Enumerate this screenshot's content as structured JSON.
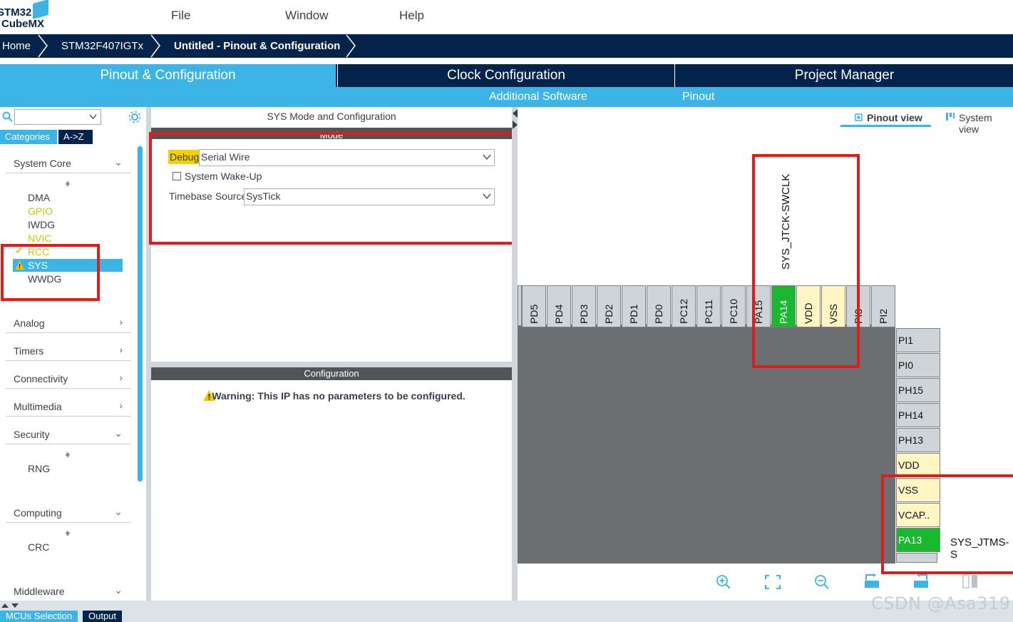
{
  "app": {
    "logo_text_line1": "STM32",
    "logo_text_line2": "CubeMX"
  },
  "menu": [
    "File",
    "Window",
    "Help"
  ],
  "breadcrumb": [
    "Home",
    "STM32F407IGTx",
    "Untitled - Pinout & Configuration"
  ],
  "tabs": [
    "Pinout & Configuration",
    "Clock Configuration",
    "Project Manager"
  ],
  "subtabs": {
    "additional": "Additional Software",
    "pinout": "Pinout"
  },
  "left": {
    "category_tabs": [
      "Categories",
      "A->Z"
    ],
    "groups": {
      "system_core": "System Core",
      "analog": "Analog",
      "timers": "Timers",
      "connectivity": "Connectivity",
      "multimedia": "Multimedia",
      "security": "Security",
      "computing": "Computing",
      "middleware": "Middleware"
    },
    "system_core_items": [
      "DMA",
      "GPIO",
      "IWDG",
      "NVIC",
      "RCC",
      "SYS",
      "WWDG"
    ],
    "security_items": [
      "RNG"
    ],
    "computing_items": [
      "CRC"
    ]
  },
  "middle": {
    "title": "SYS Mode and Configuration",
    "mode_bar": "Mode",
    "debug_label": "Debug",
    "debug_value": "Serial Wire",
    "wakeup_label": "System Wake-Up",
    "timebase_label": "Timebase Source",
    "timebase_value": "SysTick",
    "config_bar": "Configuration",
    "warning": "Warning: This IP has no parameters to be configured."
  },
  "right": {
    "view_tabs": [
      "Pinout view",
      "System view"
    ],
    "top_pins": [
      "PD5",
      "PD4",
      "PD3",
      "PD2",
      "PD1",
      "PD0",
      "PC12",
      "PC11",
      "PC10",
      "PA15",
      "PA14",
      "VDD",
      "VSS",
      "PI3",
      "PI2"
    ],
    "top_signal": "SYS_JTCK-SWCLK",
    "right_pins": [
      "PI1",
      "PI0",
      "PH15",
      "PH14",
      "PH13",
      "VDD",
      "VSS",
      "VCAP..",
      "PA13"
    ],
    "right_signal": "SYS_JTMS-S"
  },
  "bottom_tabs": [
    "MCUs Selection",
    "Output"
  ],
  "watermark": "CSDN @Asa319",
  "colors": {
    "navy": "#03234b",
    "accent": "#3cb4e6",
    "pin_green": "#19b82e",
    "highlight": "#e11a1a",
    "debug_label_bg": "#f5d000"
  }
}
